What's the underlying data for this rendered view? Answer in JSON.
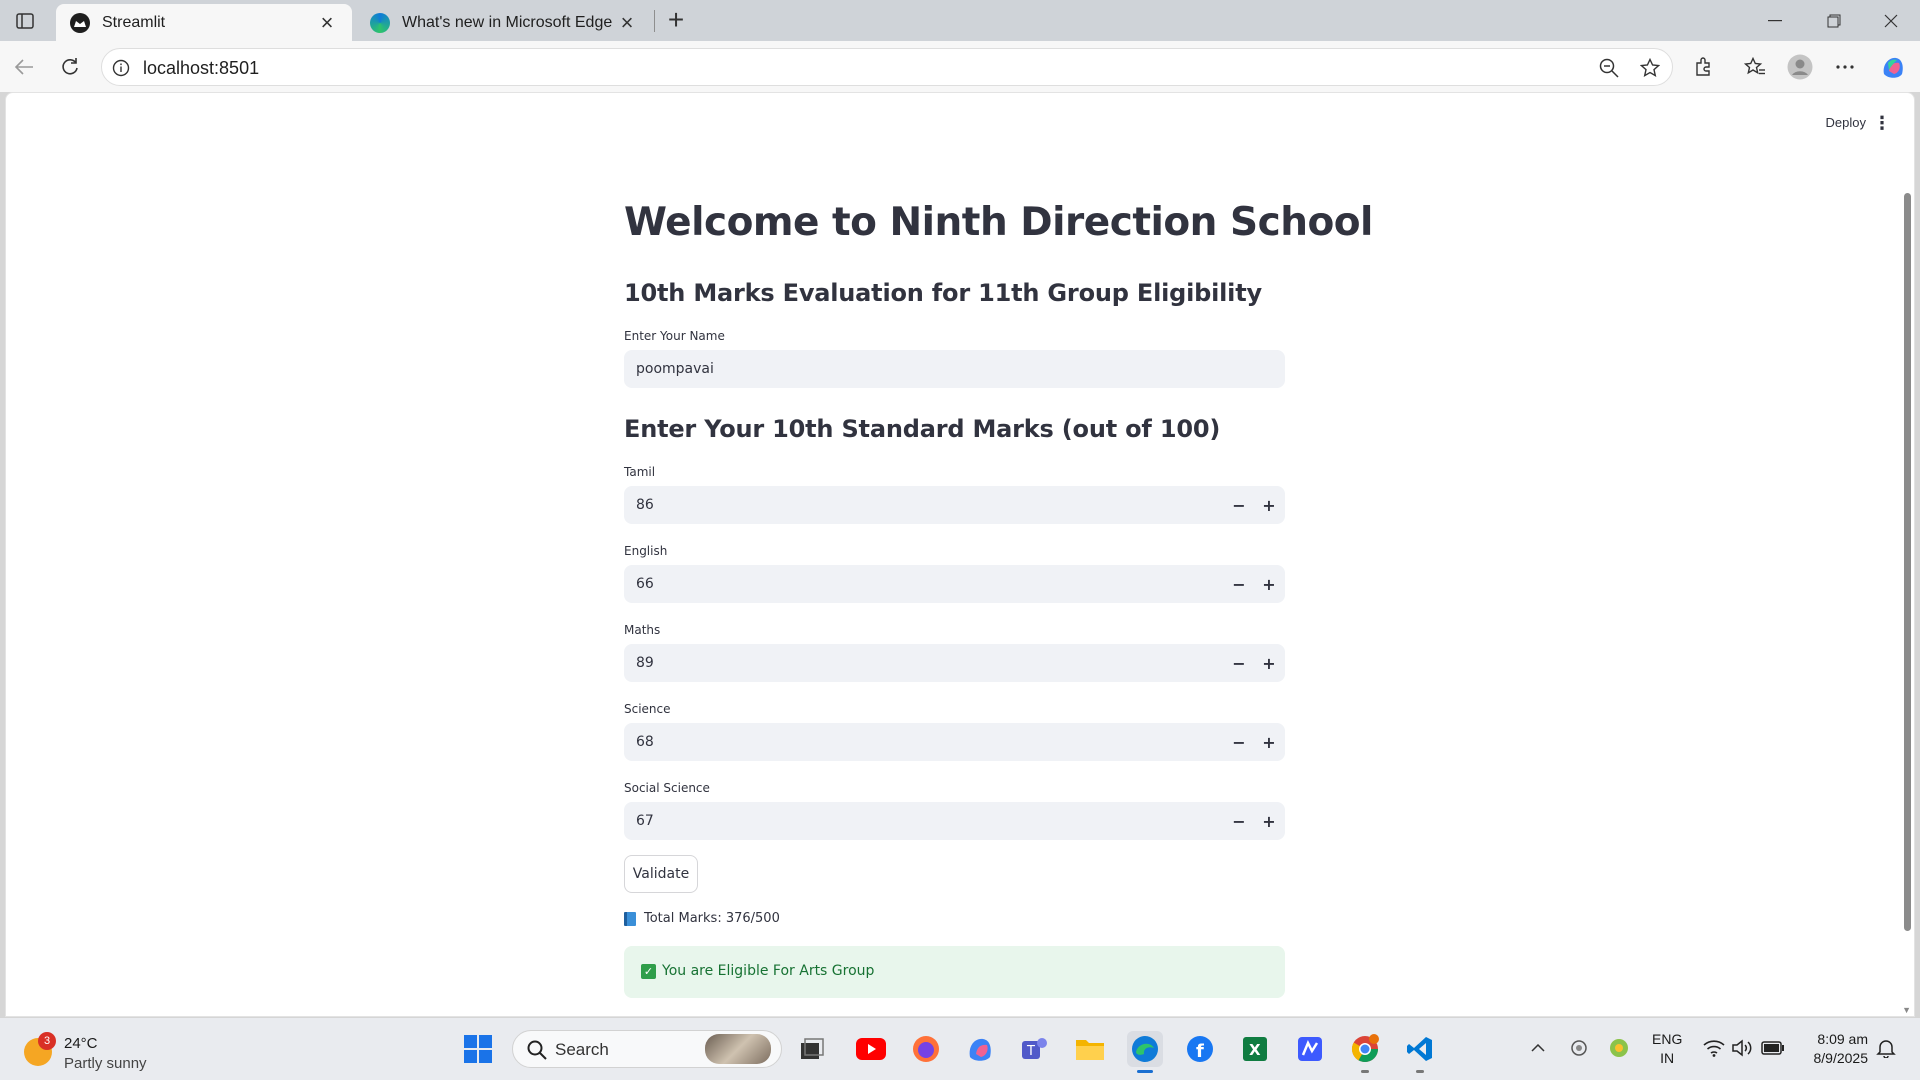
{
  "browser": {
    "tabs": [
      {
        "title": "Streamlit",
        "active": true
      },
      {
        "title": "What's new in Microsoft Edge",
        "active": false
      }
    ],
    "url": "localhost:8501"
  },
  "app": {
    "deploy_label": "Deploy",
    "title": "Welcome to Ninth Direction School",
    "subtitle": "10th Marks Evaluation for 11th Group Eligibility",
    "name_label": "Enter Your Name",
    "name_value": "poompavai",
    "marks_heading": "Enter Your 10th Standard Marks (out of 100)",
    "subjects": [
      {
        "label": "Tamil",
        "value": "86"
      },
      {
        "label": "English",
        "value": "66"
      },
      {
        "label": "Maths",
        "value": "89"
      },
      {
        "label": "Science",
        "value": "68"
      },
      {
        "label": "Social Science",
        "value": "67"
      }
    ],
    "stepper_minus": "−",
    "stepper_plus": "+",
    "validate_label": "Validate",
    "total_text": "Total Marks: 376/500",
    "result_text": "You are Eligible For Arts Group"
  },
  "taskbar": {
    "weather_badge": "3",
    "temperature": "24°C",
    "condition": "Partly sunny",
    "search_label": "Search",
    "lang_line1": "ENG",
    "lang_line2": "IN",
    "time": "8:09 am",
    "date": "8/9/2025",
    "apps": [
      "youtube-icon",
      "firefox-icon",
      "copilot-icon",
      "teams-icon",
      "file-explorer-icon",
      "edge-icon",
      "facebook-icon",
      "excel-icon",
      "app-icon",
      "chrome-icon",
      "vscode-icon"
    ]
  },
  "colors": {
    "accent": "#1a6fd1",
    "field_bg": "#f0f2f6",
    "success_bg": "#e8f6ec",
    "success_text": "#177233"
  }
}
